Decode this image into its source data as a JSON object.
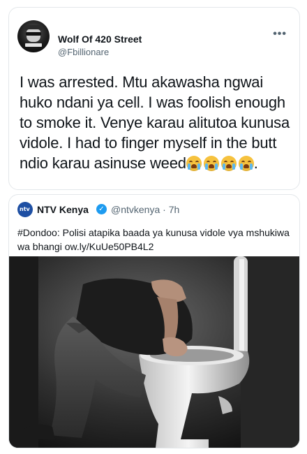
{
  "tweet": {
    "display_name": "Wolf Of 420 Street",
    "handle": "@Fbillionare",
    "more_icon": "more-horizontal-icon",
    "text": "I was arrested. Mtu akawasha ngwai huko ndani ya cell. I was foolish enough to smoke it. Venye karau alitutoa kunusa vidole. I had to finger myself in the butt ndio karau asinuse weed",
    "emoji": "crying-face-icon",
    "trailing": "."
  },
  "quote": {
    "display_name": "NTV Kenya",
    "verified_icon": "verified-badge-icon",
    "meta": "@ntvkenya · 7h",
    "logo_text": "ntv",
    "text": "#Dondoo: Polisi atapika baada ya kunusa vidole vya mshukiwa wa bhangi ow.ly/KuUe50PB4L2"
  },
  "colors": {
    "accent": "#1d9bf0",
    "ntv_blue": "#1e4fa3",
    "muted": "#536471"
  }
}
